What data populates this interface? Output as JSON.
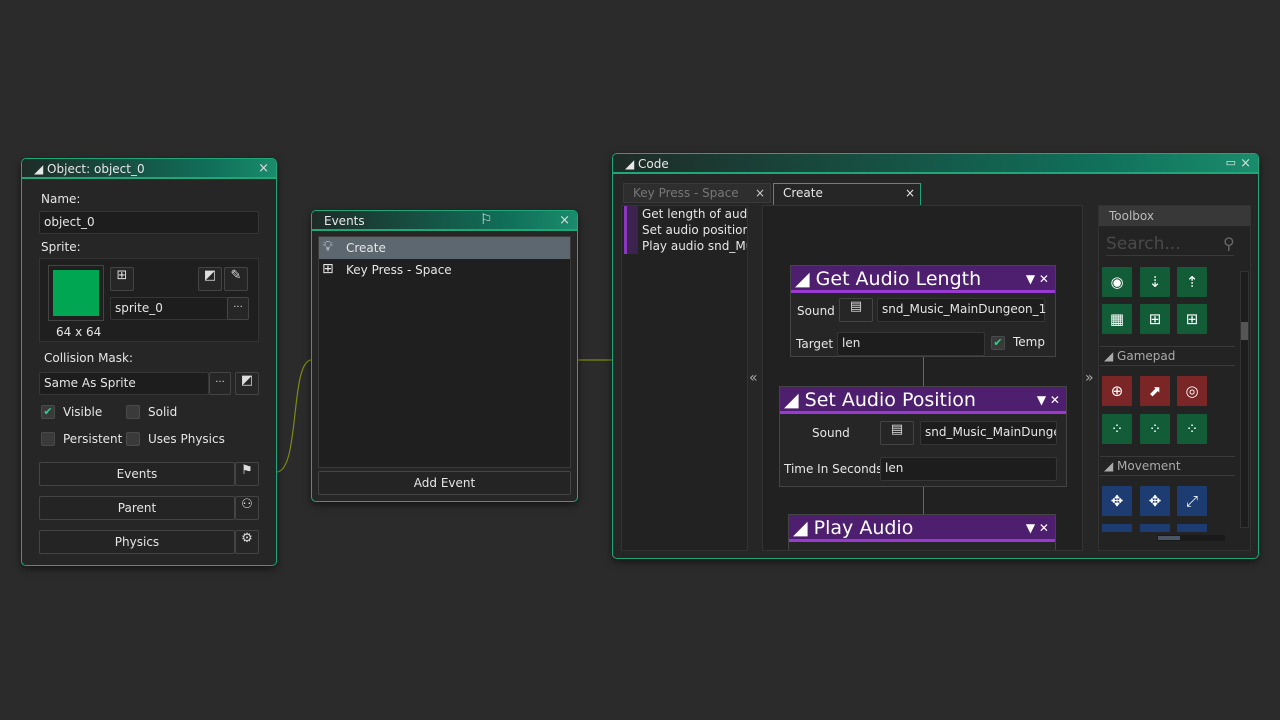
{
  "object_window": {
    "title": "Object: object_0",
    "name_label": "Name:",
    "name_value": "object_0",
    "sprite_label": "Sprite:",
    "sprite_name": "sprite_0",
    "sprite_size": "64 x 64",
    "sprite_color": "#00a651",
    "collision_label": "Collision Mask:",
    "collision_value": "Same As Sprite",
    "checkboxes": [
      {
        "label": "Visible",
        "checked": true
      },
      {
        "label": "Solid",
        "checked": false
      },
      {
        "label": "Persistent",
        "checked": false
      },
      {
        "label": "Uses Physics",
        "checked": false
      }
    ],
    "buttons": [
      "Events",
      "Parent",
      "Physics"
    ],
    "ellipsis": "···"
  },
  "events_window": {
    "title": "Events",
    "items": [
      {
        "label": "Create",
        "icon": "lightbulb-icon",
        "selected": true
      },
      {
        "label": "Key Press - Space",
        "icon": "key-grid-icon",
        "selected": false
      }
    ],
    "add_button": "Add Event"
  },
  "code_window": {
    "title": "Code",
    "tabs": [
      {
        "label": "Key Press - Space",
        "active": false
      },
      {
        "label": "Create",
        "active": true
      }
    ],
    "list": [
      "Get length of audio",
      "Set audio position o",
      "Play audio snd_Mus"
    ],
    "collapse_left": "«",
    "collapse_right": "»",
    "blocks": [
      {
        "title": "Get Audio Length",
        "fields": [
          {
            "label": "Sound",
            "value": "snd_Music_MainDungeon_1"
          },
          {
            "label": "Target",
            "value": "len"
          }
        ],
        "temp_label": "Temp",
        "temp_checked": true
      },
      {
        "title": "Set Audio Position",
        "fields": [
          {
            "label": "Sound",
            "value": "snd_Music_MainDunge"
          },
          {
            "label": "Time In Seconds",
            "value": "len"
          }
        ]
      },
      {
        "title": "Play Audio"
      }
    ],
    "toolbox": {
      "title": "Toolbox",
      "search_placeholder": "Search...",
      "sections": [
        "Gamepad",
        "Movement"
      ]
    }
  },
  "accent_color": "#1fa77a",
  "block_color": "#4e1f6e"
}
